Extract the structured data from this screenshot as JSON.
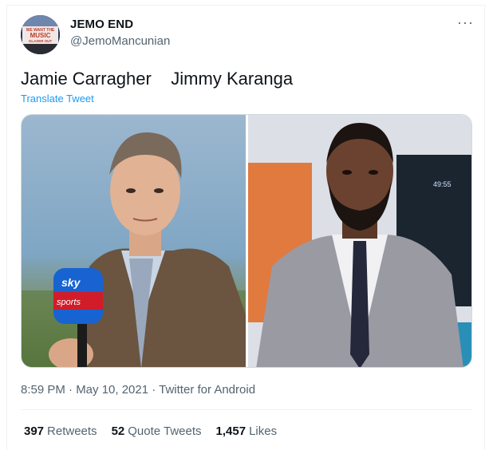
{
  "tweet": {
    "author_name": "JEMO END",
    "author_handle": "@JemoMancunian",
    "avatar_text_line1": "WE WANT THE",
    "avatar_text_line2": "MUSIC",
    "avatar_text_line3": "GLAZER OUT",
    "more_icon": "more-dots-icon",
    "text": "Jamie Carragher    Jimmy Karanga",
    "translate_label": "Translate Tweet",
    "images": [
      {
        "name": "left-photo",
        "mic_text_top": "sky",
        "mic_text_bottom": "sports"
      },
      {
        "name": "right-photo",
        "clock_text": "49:55"
      }
    ],
    "timestamp": "8:59 PM · May 10, 2021 · Twitter for Android",
    "stats": [
      {
        "count": "397",
        "label": "Retweets"
      },
      {
        "count": "52",
        "label": "Quote Tweets"
      },
      {
        "count": "1,457",
        "label": "Likes"
      }
    ]
  },
  "colors": {
    "link_blue": "#1d9bf0",
    "secondary_text": "#536471",
    "primary_text": "#0f1419",
    "divider": "#eff3f4"
  }
}
